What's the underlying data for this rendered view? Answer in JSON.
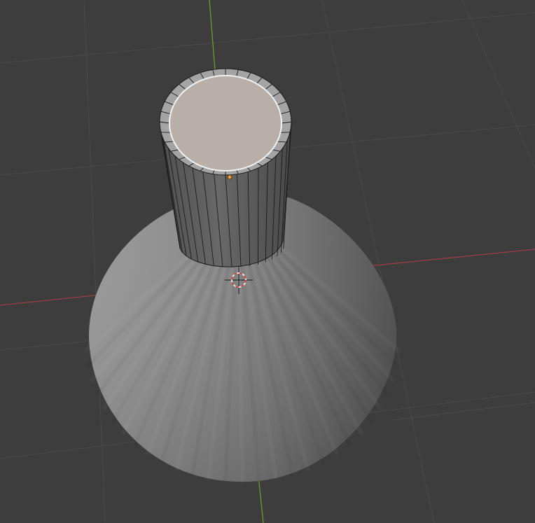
{
  "viewport": {
    "view": "3D Viewport",
    "background_color": "#3d3d3d",
    "grid_color": "#4a4a4a",
    "x_axis_color": "#9b3e48",
    "y_axis_color": "#6f9a2c"
  },
  "scene": {
    "objects": [
      {
        "name": "cone",
        "shading": "solid",
        "color": "#8c8c8c"
      },
      {
        "name": "cylinder",
        "mode": "edit",
        "color": "#5e5e5e",
        "selected_face": "top",
        "selected_face_color": "#b8afa8"
      }
    ],
    "cursor_3d": {
      "name": "3d-cursor",
      "colors": [
        "#e6e6e6",
        "#d03c3c"
      ]
    },
    "origin_point": {
      "color": "#f0a030"
    }
  }
}
